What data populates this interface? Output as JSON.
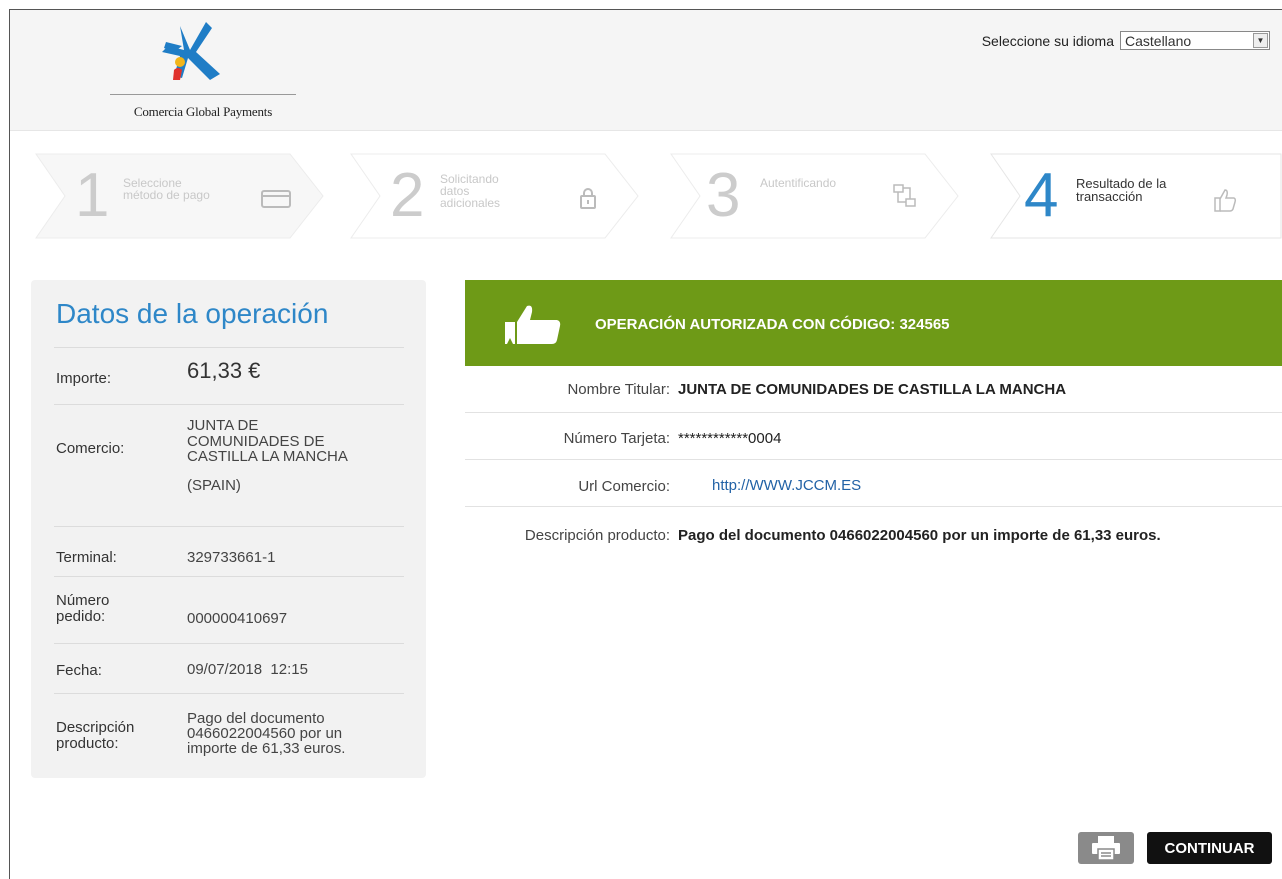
{
  "header": {
    "logo_text": "Comercia Global Payments",
    "language_label": "Seleccione su idioma",
    "language_selected": "Castellano"
  },
  "steps": [
    {
      "number": "1",
      "label": "Seleccione método de pago",
      "icon": "card-icon"
    },
    {
      "number": "2",
      "label": "Solicitando datos adicionales",
      "icon": "lock-icon"
    },
    {
      "number": "3",
      "label": "Autentificando",
      "icon": "flow-icon"
    },
    {
      "number": "4",
      "label": "Resultado de la transacción",
      "icon": "thumbs-up-icon"
    }
  ],
  "operation": {
    "title": "Datos de la operación",
    "importe_label": "Importe:",
    "importe_value": "61,33 €",
    "comercio_label": "Comercio:",
    "comercio_value_lines": [
      "JUNTA DE",
      "COMUNIDADES DE",
      "CASTILLA LA MANCHA"
    ],
    "comercio_country": "(SPAIN)",
    "terminal_label": "Terminal:",
    "terminal_value": "329733661-1",
    "pedido_label_lines": [
      "Número",
      "pedido:"
    ],
    "pedido_value": "000000410697",
    "fecha_label": "Fecha:",
    "fecha_value": "09/07/2018  12:15",
    "descripcion_label_lines": [
      "Descripción",
      "producto:"
    ],
    "descripcion_value_lines": [
      "Pago del documento",
      "0466022004560 por un",
      "importe de 61,33 euros."
    ]
  },
  "result": {
    "banner_text": "OPERACIÓN AUTORIZADA CON CÓDIGO: 324565",
    "titular_label": "Nombre Titular:",
    "titular_value": "JUNTA DE COMUNIDADES DE CASTILLA LA MANCHA",
    "tarjeta_label": "Número Tarjeta:",
    "tarjeta_value": "************0004",
    "url_label": "Url Comercio:",
    "url_value": "http://WWW.JCCM.ES",
    "descripcion_label": "Descripción producto:",
    "descripcion_value": "Pago del documento 0466022004560 por un importe de 61,33 euros."
  },
  "buttons": {
    "continue_label": "CONTINUAR",
    "print_icon": "printer-icon"
  },
  "colors": {
    "accent_blue": "#2e87c8",
    "success_green": "#6e9a17",
    "button_black": "#111111"
  }
}
